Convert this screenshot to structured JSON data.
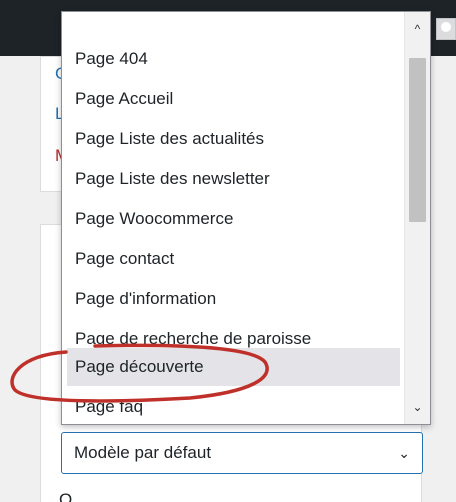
{
  "dropdown": {
    "options": [
      "Page 404",
      "Page Accueil",
      "Page Liste des actualités",
      "Page Liste des newsletter",
      "Page Woocommerce",
      "Page contact",
      "Page d'information",
      "Page de recherche de paroisse",
      "Page découverte",
      "Page faq"
    ],
    "highlighted": "Page découverte",
    "scroll_up_glyph": "^",
    "scroll_down_glyph": "⌄"
  },
  "template_select": {
    "value": "Modèle par défaut",
    "chevron": "⌄"
  },
  "background": {
    "link_a": "G",
    "link_b": "L",
    "link_c": "M",
    "tab_mark": "_",
    "below_text": "O"
  },
  "colors": {
    "accent": "#2271b1",
    "admin_bar": "#1d2327",
    "annotation": "#c0302a"
  },
  "icons": {
    "avatar": "user-avatar-icon"
  }
}
